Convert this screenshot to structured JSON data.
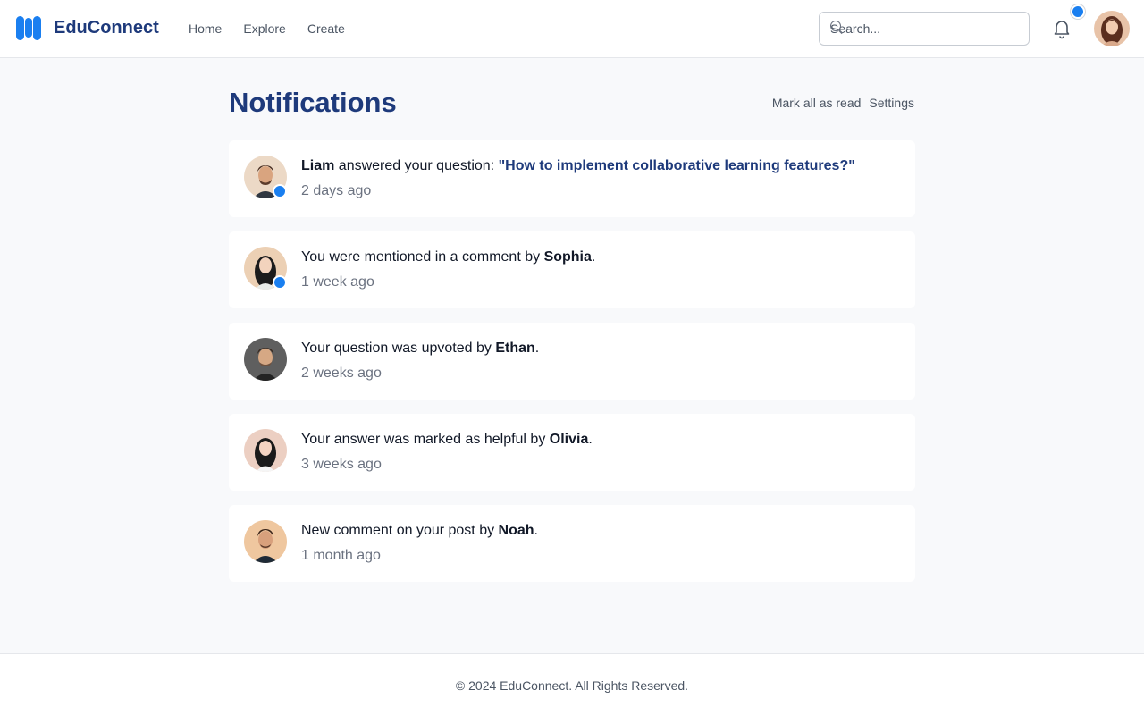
{
  "header": {
    "brand": "EduConnect",
    "nav": [
      "Home",
      "Explore",
      "Create"
    ],
    "search_placeholder": "Search...",
    "notification_dot_color": "#1a7ff0"
  },
  "page": {
    "title": "Notifications",
    "mark_all_read": "Mark all as read",
    "settings": "Settings"
  },
  "notifications": [
    {
      "name": "Liam",
      "prefix": "",
      "middle": " answered your question: ",
      "question": "\"How to implement collaborative learning features?\"",
      "suffix": "",
      "time": "2 days ago",
      "unread": true
    },
    {
      "prefix": "You were mentioned in a comment by ",
      "name": "Sophia",
      "suffix": ".",
      "time": "1 week ago",
      "unread": true
    },
    {
      "prefix": "Your question was upvoted by ",
      "name": "Ethan",
      "suffix": ".",
      "time": "2 weeks ago",
      "unread": false
    },
    {
      "prefix": "Your answer was marked as helpful by ",
      "name": "Olivia",
      "suffix": ".",
      "time": "3 weeks ago",
      "unread": false
    },
    {
      "prefix": "New comment on your post by ",
      "name": "Noah",
      "suffix": ".",
      "time": "1 month ago",
      "unread": false
    }
  ],
  "footer": {
    "copyright": "© 2024 EduConnect. All Rights Reserved."
  },
  "colors": {
    "accent": "#1a7ff0",
    "title": "#1e3a7b",
    "background": "#f8f9fb"
  }
}
